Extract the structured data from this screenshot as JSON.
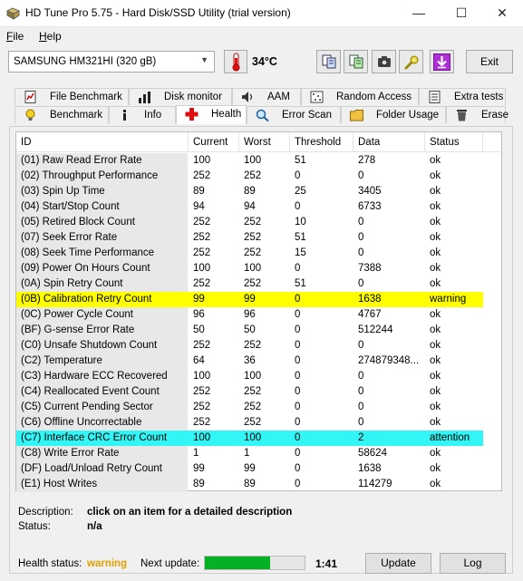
{
  "window": {
    "title": "HD Tune Pro 5.75 - Hard Disk/SSD Utility (trial version)"
  },
  "menu": {
    "file": "File",
    "help": "Help"
  },
  "toolbar": {
    "drive": "SAMSUNG HM321HI (320 gB)",
    "temperature": "34°C",
    "exit_label": "Exit"
  },
  "tabs_top": [
    "File Benchmark",
    "Disk monitor",
    "AAM",
    "Random Access",
    "Extra tests"
  ],
  "tabs_bottom": [
    "Benchmark",
    "Info",
    "Health",
    "Error Scan",
    "Folder Usage",
    "Erase"
  ],
  "active_tab": "Health",
  "table": {
    "headers": [
      "ID",
      "Current",
      "Worst",
      "Threshold",
      "Data",
      "Status"
    ],
    "rows": [
      {
        "id": "(01) Raw Read Error Rate",
        "current": "100",
        "worst": "100",
        "threshold": "51",
        "data": "278",
        "status": "ok"
      },
      {
        "id": "(02) Throughput Performance",
        "current": "252",
        "worst": "252",
        "threshold": "0",
        "data": "0",
        "status": "ok"
      },
      {
        "id": "(03) Spin Up Time",
        "current": "89",
        "worst": "89",
        "threshold": "25",
        "data": "3405",
        "status": "ok"
      },
      {
        "id": "(04) Start/Stop Count",
        "current": "94",
        "worst": "94",
        "threshold": "0",
        "data": "6733",
        "status": "ok"
      },
      {
        "id": "(05) Retired Block Count",
        "current": "252",
        "worst": "252",
        "threshold": "10",
        "data": "0",
        "status": "ok"
      },
      {
        "id": "(07) Seek Error Rate",
        "current": "252",
        "worst": "252",
        "threshold": "51",
        "data": "0",
        "status": "ok"
      },
      {
        "id": "(08) Seek Time Performance",
        "current": "252",
        "worst": "252",
        "threshold": "15",
        "data": "0",
        "status": "ok"
      },
      {
        "id": "(09) Power On Hours Count",
        "current": "100",
        "worst": "100",
        "threshold": "0",
        "data": "7388",
        "status": "ok"
      },
      {
        "id": "(0A) Spin Retry Count",
        "current": "252",
        "worst": "252",
        "threshold": "51",
        "data": "0",
        "status": "ok"
      },
      {
        "id": "(0B) Calibration Retry Count",
        "current": "99",
        "worst": "99",
        "threshold": "0",
        "data": "1638",
        "status": "warning",
        "highlight": "warning"
      },
      {
        "id": "(0C) Power Cycle Count",
        "current": "96",
        "worst": "96",
        "threshold": "0",
        "data": "4767",
        "status": "ok"
      },
      {
        "id": "(BF) G-sense Error Rate",
        "current": "50",
        "worst": "50",
        "threshold": "0",
        "data": "512244",
        "status": "ok"
      },
      {
        "id": "(C0) Unsafe Shutdown Count",
        "current": "252",
        "worst": "252",
        "threshold": "0",
        "data": "0",
        "status": "ok"
      },
      {
        "id": "(C2) Temperature",
        "current": "64",
        "worst": "36",
        "threshold": "0",
        "data": "274879348...",
        "status": "ok"
      },
      {
        "id": "(C3) Hardware ECC Recovered",
        "current": "100",
        "worst": "100",
        "threshold": "0",
        "data": "0",
        "status": "ok"
      },
      {
        "id": "(C4) Reallocated Event Count",
        "current": "252",
        "worst": "252",
        "threshold": "0",
        "data": "0",
        "status": "ok"
      },
      {
        "id": "(C5) Current Pending Sector",
        "current": "252",
        "worst": "252",
        "threshold": "0",
        "data": "0",
        "status": "ok"
      },
      {
        "id": "(C6) Offline Uncorrectable",
        "current": "252",
        "worst": "252",
        "threshold": "0",
        "data": "0",
        "status": "ok"
      },
      {
        "id": "(C7) Interface CRC Error Count",
        "current": "100",
        "worst": "100",
        "threshold": "0",
        "data": "2",
        "status": "attention",
        "highlight": "attention"
      },
      {
        "id": "(C8) Write Error Rate",
        "current": "1",
        "worst": "1",
        "threshold": "0",
        "data": "58624",
        "status": "ok"
      },
      {
        "id": "(DF) Load/Unload Retry Count",
        "current": "99",
        "worst": "99",
        "threshold": "0",
        "data": "1638",
        "status": "ok"
      },
      {
        "id": "(E1) Host Writes",
        "current": "89",
        "worst": "89",
        "threshold": "0",
        "data": "114279",
        "status": "ok"
      }
    ]
  },
  "description": {
    "label": "Description:",
    "text": "click on an item for a detailed description",
    "status_label": "Status:",
    "status_value": "n/a"
  },
  "footer": {
    "health_label": "Health status:",
    "health_value": "warning",
    "next_label": "Next update:",
    "progress": 0.65,
    "countdown": "1:41",
    "update_label": "Update",
    "log_label": "Log"
  },
  "colors": {
    "warning_text": "#e0a000",
    "warning_row": "#ffff00",
    "attention_row": "#33f5f5",
    "progress": "#06b025"
  }
}
